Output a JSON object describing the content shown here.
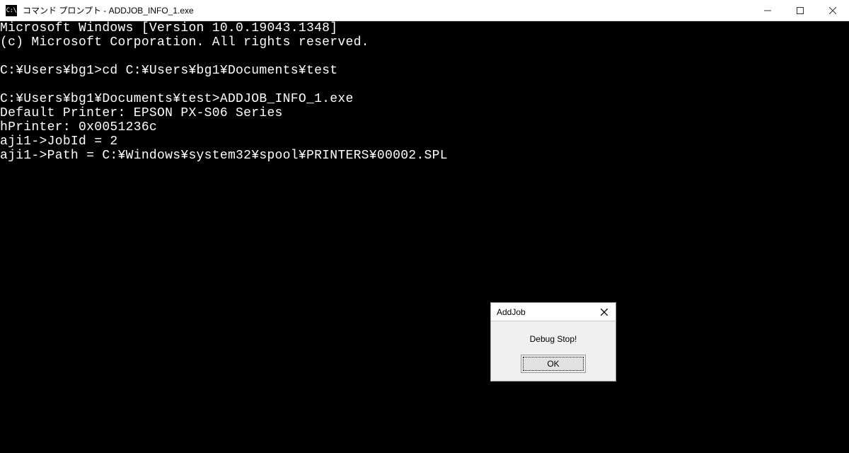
{
  "window": {
    "title": "コマンド プロンプト - ADDJOB_INFO_1.exe",
    "icon_label": "C:\\"
  },
  "console": {
    "lines": [
      "Microsoft Windows [Version 10.0.19043.1348]",
      "(c) Microsoft Corporation. All rights reserved.",
      "",
      "C:¥Users¥bg1>cd C:¥Users¥bg1¥Documents¥test",
      "",
      "C:¥Users¥bg1¥Documents¥test>ADDJOB_INFO_1.exe",
      "Default Printer: EPSON PX-S06 Series",
      "hPrinter: 0x0051236c",
      "aji1->JobId = 2",
      "aji1->Path = C:¥Windows¥system32¥spool¥PRINTERS¥00002.SPL"
    ]
  },
  "dialog": {
    "title": "AddJob",
    "message": "Debug Stop!",
    "ok_label": "OK"
  }
}
